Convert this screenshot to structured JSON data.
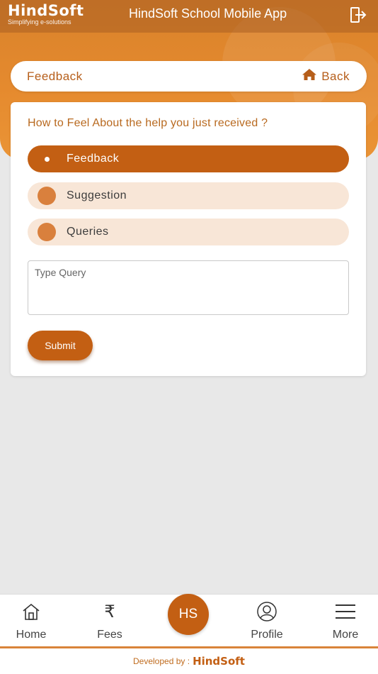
{
  "header": {
    "brand_name": "HindSoft",
    "brand_tagline": "Simplifying e-solutions",
    "app_title": "HindSoft School Mobile App",
    "logout_icon": "logout-icon"
  },
  "title_bar": {
    "title": "Feedback",
    "back_label": "Back",
    "back_icon": "home-icon"
  },
  "form": {
    "question": "How to Feel About the help you just received ?",
    "options": [
      {
        "label": "Feedback",
        "selected": true
      },
      {
        "label": "Suggestion",
        "selected": false
      },
      {
        "label": "Queries",
        "selected": false
      }
    ],
    "query_placeholder": "Type Query",
    "query_value": "",
    "submit_label": "Submit"
  },
  "bottom_nav": {
    "items": [
      {
        "label": "Home",
        "icon": "home-icon"
      },
      {
        "label": "Fees",
        "icon": "rupee-icon"
      },
      {
        "label": "HS",
        "icon": "hs-badge"
      },
      {
        "label": "Profile",
        "icon": "profile-icon"
      },
      {
        "label": "More",
        "icon": "menu-icon"
      }
    ]
  },
  "footer": {
    "developed_by": "Developed by :",
    "logo": "HindSoft"
  },
  "colors": {
    "primary": "#c35f13",
    "banner": "#e58a2e",
    "option_bg": "#f8e6d7",
    "radio": "#d9803d"
  }
}
